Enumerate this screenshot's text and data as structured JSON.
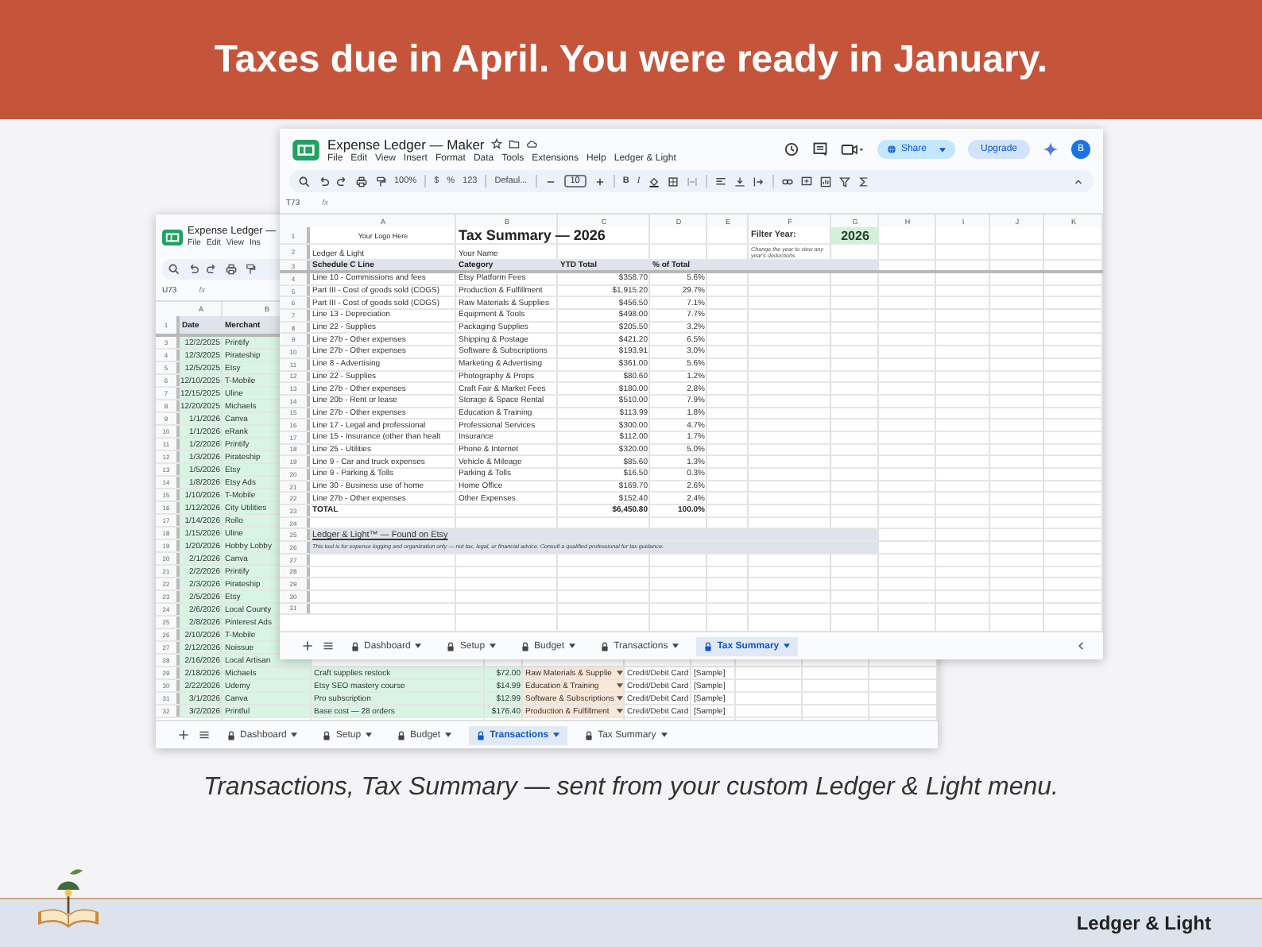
{
  "banner": {
    "title": "Taxes due in April. You were ready in January."
  },
  "back_window": {
    "title": "Expense Ledger —",
    "menu": [
      "File",
      "Edit",
      "View",
      "Ins"
    ],
    "name_box": "U73",
    "formula_label": "fx",
    "columns": [
      "A",
      "B"
    ],
    "header": [
      "Date",
      "Merchant"
    ],
    "row_numbers": [
      "1",
      "3",
      "4",
      "5",
      "6",
      "7",
      "8",
      "9",
      "10",
      "11",
      "12",
      "13",
      "14",
      "15",
      "16",
      "17",
      "18",
      "19",
      "20",
      "21",
      "22",
      "23",
      "24",
      "25",
      "26",
      "27",
      "28",
      "29",
      "30",
      "31",
      "32"
    ],
    "rows": [
      {
        "date": "12/2/2025",
        "merchant": "Printify"
      },
      {
        "date": "12/3/2025",
        "merchant": "Pirateship"
      },
      {
        "date": "12/5/2025",
        "merchant": "Etsy"
      },
      {
        "date": "12/10/2025",
        "merchant": "T-Mobile"
      },
      {
        "date": "12/15/2025",
        "merchant": "Uline"
      },
      {
        "date": "12/20/2025",
        "merchant": "Michaels"
      },
      {
        "date": "1/1/2026",
        "merchant": "Canva"
      },
      {
        "date": "1/1/2026",
        "merchant": "eRank"
      },
      {
        "date": "1/2/2026",
        "merchant": "Printify"
      },
      {
        "date": "1/3/2026",
        "merchant": "Pirateship"
      },
      {
        "date": "1/5/2026",
        "merchant": "Etsy"
      },
      {
        "date": "1/8/2026",
        "merchant": "Etsy Ads"
      },
      {
        "date": "1/10/2026",
        "merchant": "T-Mobile"
      },
      {
        "date": "1/12/2026",
        "merchant": "City Utilities"
      },
      {
        "date": "1/14/2026",
        "merchant": "Rollo"
      },
      {
        "date": "1/15/2026",
        "merchant": "Uline"
      },
      {
        "date": "1/20/2026",
        "merchant": "Hobby Lobby"
      },
      {
        "date": "2/1/2026",
        "merchant": "Canva"
      },
      {
        "date": "2/2/2026",
        "merchant": "Printify"
      },
      {
        "date": "2/3/2026",
        "merchant": "Pirateship"
      },
      {
        "date": "2/5/2026",
        "merchant": "Etsy"
      },
      {
        "date": "2/6/2026",
        "merchant": "Local County"
      },
      {
        "date": "2/8/2026",
        "merchant": "Pinterest Ads"
      },
      {
        "date": "2/10/2026",
        "merchant": "T-Mobile"
      },
      {
        "date": "2/12/2026",
        "merchant": "Noissue"
      },
      {
        "date": "2/16/2026",
        "merchant": "Local Artisan"
      }
    ],
    "full_rows": [
      {
        "date": "2/18/2026",
        "merchant": "Michaels",
        "description": "Craft supplies restock",
        "amount": "$72.00",
        "category": "Raw Materials & Supplie",
        "payment": "Credit/Debit Card",
        "note": "[Sample]"
      },
      {
        "date": "2/22/2026",
        "merchant": "Udemy",
        "description": "Etsy SEO mastery course",
        "amount": "$14.99",
        "category": "Education & Training",
        "payment": "Credit/Debit Card",
        "note": "[Sample]"
      },
      {
        "date": "3/1/2026",
        "merchant": "Canva",
        "description": "Pro subscription",
        "amount": "$12.99",
        "category": "Software & Subscriptions",
        "payment": "Credit/Debit Card",
        "note": "[Sample]"
      },
      {
        "date": "3/2/2026",
        "merchant": "Printful",
        "description": "Base cost — 28 orders",
        "amount": "$176.40",
        "category": "Production & Fulfillment",
        "payment": "Credit/Debit Card",
        "note": "[Sample]"
      }
    ],
    "sheet_tabs": [
      {
        "label": "Dashboard",
        "selected": false
      },
      {
        "label": "Setup",
        "selected": false
      },
      {
        "label": "Budget",
        "selected": false
      },
      {
        "label": "Transactions",
        "selected": true
      },
      {
        "label": "Tax Summary",
        "selected": false
      }
    ]
  },
  "front_window": {
    "title": "Expense Ledger — Maker",
    "menu": [
      "File",
      "Edit",
      "View",
      "Insert",
      "Format",
      "Data",
      "Tools",
      "Extensions",
      "Help",
      "Ledger & Light"
    ],
    "share": "Share",
    "upgrade": "Upgrade",
    "avatar": "B",
    "toolbar": {
      "zoom": "100%",
      "number_formats": [
        "$",
        "%",
        "123"
      ],
      "font": "Defaul...",
      "font_size": "10",
      "styles": [
        "B",
        "I"
      ]
    },
    "name_box": "T73",
    "formula_label": "fx",
    "columns": [
      "A",
      "B",
      "C",
      "D",
      "E",
      "F",
      "G",
      "H",
      "I",
      "J",
      "K"
    ],
    "row_numbers": [
      "1",
      "2",
      "3",
      "4",
      "5",
      "6",
      "7",
      "8",
      "9",
      "10",
      "11",
      "12",
      "13",
      "14",
      "15",
      "16",
      "17",
      "18",
      "19",
      "20",
      "21",
      "22",
      "23",
      "24",
      "25",
      "26",
      "27",
      "28",
      "29",
      "30",
      "31"
    ],
    "logo_placeholder": "Your Logo Here",
    "sheet_title": "Tax Summary — 2026",
    "brand": "Ledger & Light",
    "owner": "Your Name",
    "filter": {
      "label": "Filter Year:",
      "value": "2026",
      "hint": "Change the year to view any year's deductions"
    },
    "headers": [
      "Schedule C Line",
      "Category",
      "YTD Total",
      "% of Total"
    ],
    "rows": [
      {
        "line": "Line 10 - Commissions and fees",
        "category": "Etsy Platform Fees",
        "total": "$358.70",
        "percent": "5.6%"
      },
      {
        "line": "Part III - Cost of goods sold (COGS)",
        "category": "Production & Fulfillment",
        "total": "$1,915.20",
        "percent": "29.7%"
      },
      {
        "line": "Part III - Cost of goods sold (COGS)",
        "category": "Raw Materials & Supplies",
        "total": "$456.50",
        "percent": "7.1%"
      },
      {
        "line": "Line 13 - Depreciation",
        "category": "Equipment & Tools",
        "total": "$498.00",
        "percent": "7.7%"
      },
      {
        "line": "Line 22 - Supplies",
        "category": "Packaging Supplies",
        "total": "$205.50",
        "percent": "3.2%"
      },
      {
        "line": "Line 27b - Other expenses",
        "category": "Shipping & Postage",
        "total": "$421.20",
        "percent": "6.5%"
      },
      {
        "line": "Line 27b - Other expenses",
        "category": "Software & Subscriptions",
        "total": "$193.91",
        "percent": "3.0%"
      },
      {
        "line": "Line 8 - Advertising",
        "category": "Marketing & Advertising",
        "total": "$361.00",
        "percent": "5.6%"
      },
      {
        "line": "Line 22 - Supplies",
        "category": "Photography & Props",
        "total": "$80.60",
        "percent": "1.2%"
      },
      {
        "line": "Line 27b - Other expenses",
        "category": "Craft Fair & Market Fees",
        "total": "$180.00",
        "percent": "2.8%"
      },
      {
        "line": "Line 20b - Rent or lease",
        "category": "Storage & Space Rental",
        "total": "$510.00",
        "percent": "7.9%"
      },
      {
        "line": "Line 27b - Other expenses",
        "category": "Education & Training",
        "total": "$113.99",
        "percent": "1.8%"
      },
      {
        "line": "Line 17 - Legal and professional",
        "category": "Professional Services",
        "total": "$300.00",
        "percent": "4.7%"
      },
      {
        "line": "Line 15 - Insurance (other than healt",
        "category": "Insurance",
        "total": "$112.00",
        "percent": "1.7%"
      },
      {
        "line": "Line 25 - Utilities",
        "category": "Phone & Internet",
        "total": "$320.00",
        "percent": "5.0%"
      },
      {
        "line": "Line 9 - Car and truck expenses",
        "category": "Vehicle & Mileage",
        "total": "$85.60",
        "percent": "1.3%"
      },
      {
        "line": "Line 9 - Parking & Tolls",
        "category": "Parking & Tolls",
        "total": "$16.50",
        "percent": "0.3%"
      },
      {
        "line": "Line 30 - Business use of home",
        "category": "Home Office",
        "total": "$169.70",
        "percent": "2.6%"
      },
      {
        "line": "Line 27b - Other expenses",
        "category": "Other Expenses",
        "total": "$152.40",
        "percent": "2.4%"
      }
    ],
    "total": {
      "label": "TOTAL",
      "total": "$6,450.80",
      "percent": "100.0%"
    },
    "link": "Ledger & Light™  —  Found on Etsy",
    "disclaimer": "This tool is for expense logging and organization only — not tax, legal, or financial advice. Consult a qualified professional for tax guidance.",
    "sheet_tabs": [
      {
        "label": "Dashboard",
        "selected": false
      },
      {
        "label": "Setup",
        "selected": false
      },
      {
        "label": "Budget",
        "selected": false
      },
      {
        "label": "Transactions",
        "selected": false
      },
      {
        "label": "Tax Summary",
        "selected": true
      }
    ]
  },
  "caption": "Transactions, Tax Summary — sent from your custom Ledger & Light menu.",
  "footer": {
    "brand": "Ledger & Light"
  }
}
